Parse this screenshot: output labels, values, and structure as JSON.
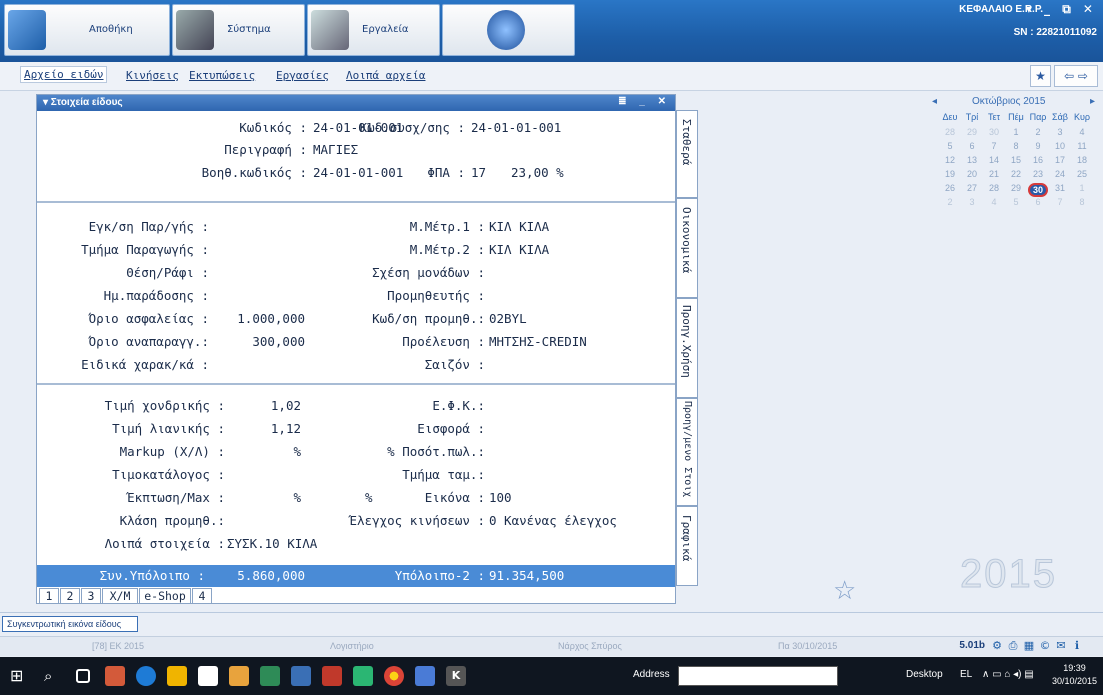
{
  "toolbar": {
    "buttons": [
      {
        "label": "Αποθήκη"
      },
      {
        "label": "Σύστημα"
      },
      {
        "label": "Εργαλεία"
      }
    ],
    "brand": "ΚΕΦΑΛΑΙΟ E.R.P.",
    "window_controls": "▾ _ ⧉ ✕",
    "serial": "SN : 22821011092"
  },
  "menu": {
    "items": [
      "Αρχείο ειδών",
      "Κινήσεις",
      "Εκτυπώσεις",
      "Εργασίες",
      "Λοιπά αρχεία"
    ]
  },
  "panel": {
    "title": "▾ Στοιχεία είδους",
    "controls": "≣ _ ✕",
    "fixed": {
      "code_label": "Κωδικός :",
      "code_value": "24-01-01-001",
      "rel_code_label": "Κωδ.συσχ/σης :",
      "rel_code_value": "24-01-01-001",
      "desc_label": "Περιγραφή :",
      "desc_value": "ΜΑΓΙΕΣ",
      "aux_label": "Βοηθ.κωδικός :",
      "aux_value": "24-01-01-001",
      "vat_label": "ΦΠΑ :",
      "vat_code": "17",
      "vat_rate": "23,00 %"
    },
    "economic": {
      "approval_label": "Εγκ/ση Παρ/γής :",
      "dept_label": "Τμήμα Παραγωγής :",
      "shelf_label": "Θέση/Ράφι :",
      "delivery_label": "Ημ.παράδοσης :",
      "safety_label": "Όριο ασφαλείας :",
      "safety_value": "1.000,000",
      "reorder_label": "Όριο αναπαραγγ.:",
      "reorder_value": "300,000",
      "special_label": "Ειδικά χαρακ/κά :",
      "unit1_label": "Μ.Μέτρ.1 :",
      "unit1_value": "ΚΙΛ ΚΙΛΑ",
      "unit2_label": "Μ.Μέτρ.2 :",
      "unit2_value": "ΚΙΛ ΚΙΛΑ",
      "units_rel_label": "Σχέση μονάδων :",
      "supplier_label": "Προμηθευτής :",
      "supplier_code_label": "Κωδ/ση προμηθ.:",
      "supplier_code_value": "02BYL",
      "origin_label": "Προέλευση :",
      "origin_value": "ΜΗΤΣΗΣ-CREDIN",
      "season_label": "Σαιζόν :"
    },
    "pricing": {
      "wholesale_label": "Τιμή χονδρικής :",
      "wholesale_value": "1,02",
      "retail_label": "Τιμή λιανικής :",
      "retail_value": "1,12",
      "markup_label": "Markup (Χ/Λ) :",
      "markup_value": "%",
      "pricelist_label": "Τιμοκατάλογος :",
      "discount_label": "Έκπτωση/Max :",
      "discount_value1": "%",
      "discount_value2": "%",
      "supply_class_label": "Κλάση προμηθ.:",
      "other_label": "Λοιπά στοιχεία :",
      "other_value": "ΣΥΣΚ.10 ΚΙΛΑ",
      "efk_label": "Ε.Φ.Κ.:",
      "contribution_label": "Εισφορά :",
      "sale_pct_label": "% Ποσότ.πωλ.:",
      "cash_dept_label": "Τμήμα ταμ.:",
      "image_label": "Εικόνα :",
      "image_value": "100",
      "move_check_label": "Έλεγχος κινήσεων :",
      "move_check_value": "0 Κανένας έλεγχος"
    },
    "balance": {
      "total_label": "Συν.Υπόλοιπο :",
      "total_value": "5.860,000",
      "balance2_label": "Υπόλοιπο-2 :",
      "balance2_value": "91.354,500"
    },
    "bottom_tabs": [
      "1",
      "2",
      "3",
      "Χ/Μ",
      "e-Shop",
      "4"
    ]
  },
  "vertical_tabs": [
    "Σταθερά",
    "Οικονομικά",
    "Προηγ.Χρήση",
    "Προηγ/μενο Στοιχ",
    "Γραφικά"
  ],
  "calendar": {
    "month": "Οκτώβριος 2015",
    "prev": "◂",
    "next": "▸",
    "weekdays": [
      "Δευ",
      "Τρί",
      "Τετ",
      "Πέμ",
      "Παρ",
      "Σάβ",
      "Κυρ"
    ],
    "weeks": [
      [
        "28",
        "29",
        "30",
        "1",
        "2",
        "3",
        "4"
      ],
      [
        "5",
        "6",
        "7",
        "8",
        "9",
        "10",
        "11"
      ],
      [
        "12",
        "13",
        "14",
        "15",
        "16",
        "17",
        "18"
      ],
      [
        "19",
        "20",
        "21",
        "22",
        "23",
        "24",
        "25"
      ],
      [
        "26",
        "27",
        "28",
        "29",
        "30",
        "31",
        "1"
      ],
      [
        "2",
        "3",
        "4",
        "5",
        "6",
        "7",
        "8"
      ]
    ],
    "selected": "30",
    "year_watermark": "2015"
  },
  "summary_button": "Συγκεντρωτική εικόνα είδους",
  "status": {
    "company": "[78] ΕΚ 2015",
    "module": "Λογιστήριο",
    "user": "Νάρχος Σπύρος",
    "date": "Πα 30/10/2015",
    "version": "5.01b"
  },
  "taskbar": {
    "address_label": "Address",
    "desktop_label": "Desktop",
    "lang": "EL",
    "time": "19:39",
    "date": "30/10/2015"
  },
  "colors": {
    "topbar": "#1d5ea8",
    "panel_header": "#2f66b0",
    "balance_bar": "#4a8bd6",
    "calendar_selected": "#2a5aa8"
  }
}
